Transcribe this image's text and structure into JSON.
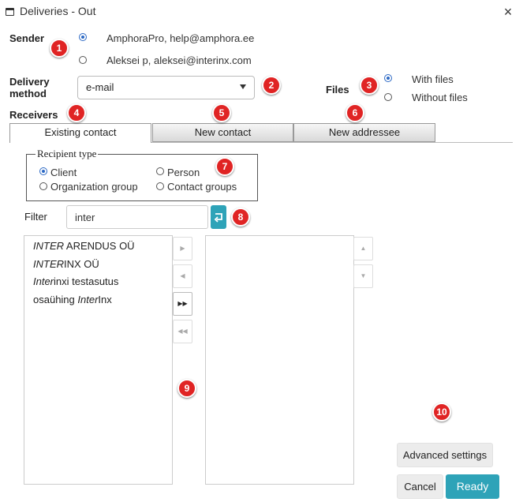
{
  "window": {
    "title": "Deliveries - Out",
    "close_glyph": "×"
  },
  "sender": {
    "label": "Sender",
    "options": [
      {
        "text": "AmphoraPro, help@amphora.ee",
        "checked": true
      },
      {
        "text": "Aleksei p, aleksei@interinx.com",
        "checked": false
      }
    ]
  },
  "delivery_method": {
    "label_line1": "Delivery",
    "label_line2": "method",
    "value": "e-mail"
  },
  "files": {
    "label": "Files",
    "options": [
      {
        "text": "With files",
        "checked": true
      },
      {
        "text": "Without files",
        "checked": false
      }
    ]
  },
  "receivers": {
    "label": "Receivers",
    "tabs": [
      {
        "label": "Existing contact",
        "active": true
      },
      {
        "label": "New contact",
        "active": false
      },
      {
        "label": "New addressee",
        "active": false
      }
    ]
  },
  "recipient_type": {
    "legend": "Recipient type",
    "options": [
      {
        "text": "Client",
        "checked": true
      },
      {
        "text": "Person",
        "checked": false
      },
      {
        "text": "Organization group",
        "checked": false
      },
      {
        "text": "Contact groups",
        "checked": false
      }
    ]
  },
  "filter": {
    "label": "Filter",
    "value": "inter",
    "refresh_icon": "refresh-icon"
  },
  "available_list": [
    {
      "italic": "INTER",
      "rest": " ARENDUS OÜ"
    },
    {
      "italic": "INTER",
      "rest": "INX OÜ"
    },
    {
      "italic": "Inter",
      "rest": "inxi testasutus"
    },
    {
      "prefix": "osaühing ",
      "italic": "Inter",
      "rest": "Inx"
    }
  ],
  "move_buttons": [
    {
      "glyph": "▶",
      "icon": "move-right-icon"
    },
    {
      "glyph": "◀",
      "icon": "move-left-icon"
    },
    {
      "glyph": "▶▶",
      "icon": "move-all-right-icon"
    },
    {
      "glyph": "◀◀",
      "icon": "move-all-left-icon"
    }
  ],
  "order_buttons": [
    {
      "glyph": "▲",
      "icon": "move-up-icon"
    },
    {
      "glyph": "▼",
      "icon": "move-down-icon"
    }
  ],
  "buttons": {
    "advanced": "Advanced settings",
    "cancel": "Cancel",
    "ready": "Ready"
  },
  "markers": [
    "1",
    "2",
    "3",
    "4",
    "5",
    "6",
    "7",
    "8",
    "9",
    "10"
  ],
  "colors": {
    "accent": "#2ea3b8",
    "marker": "#e02424",
    "radio": "#2b68c4"
  }
}
